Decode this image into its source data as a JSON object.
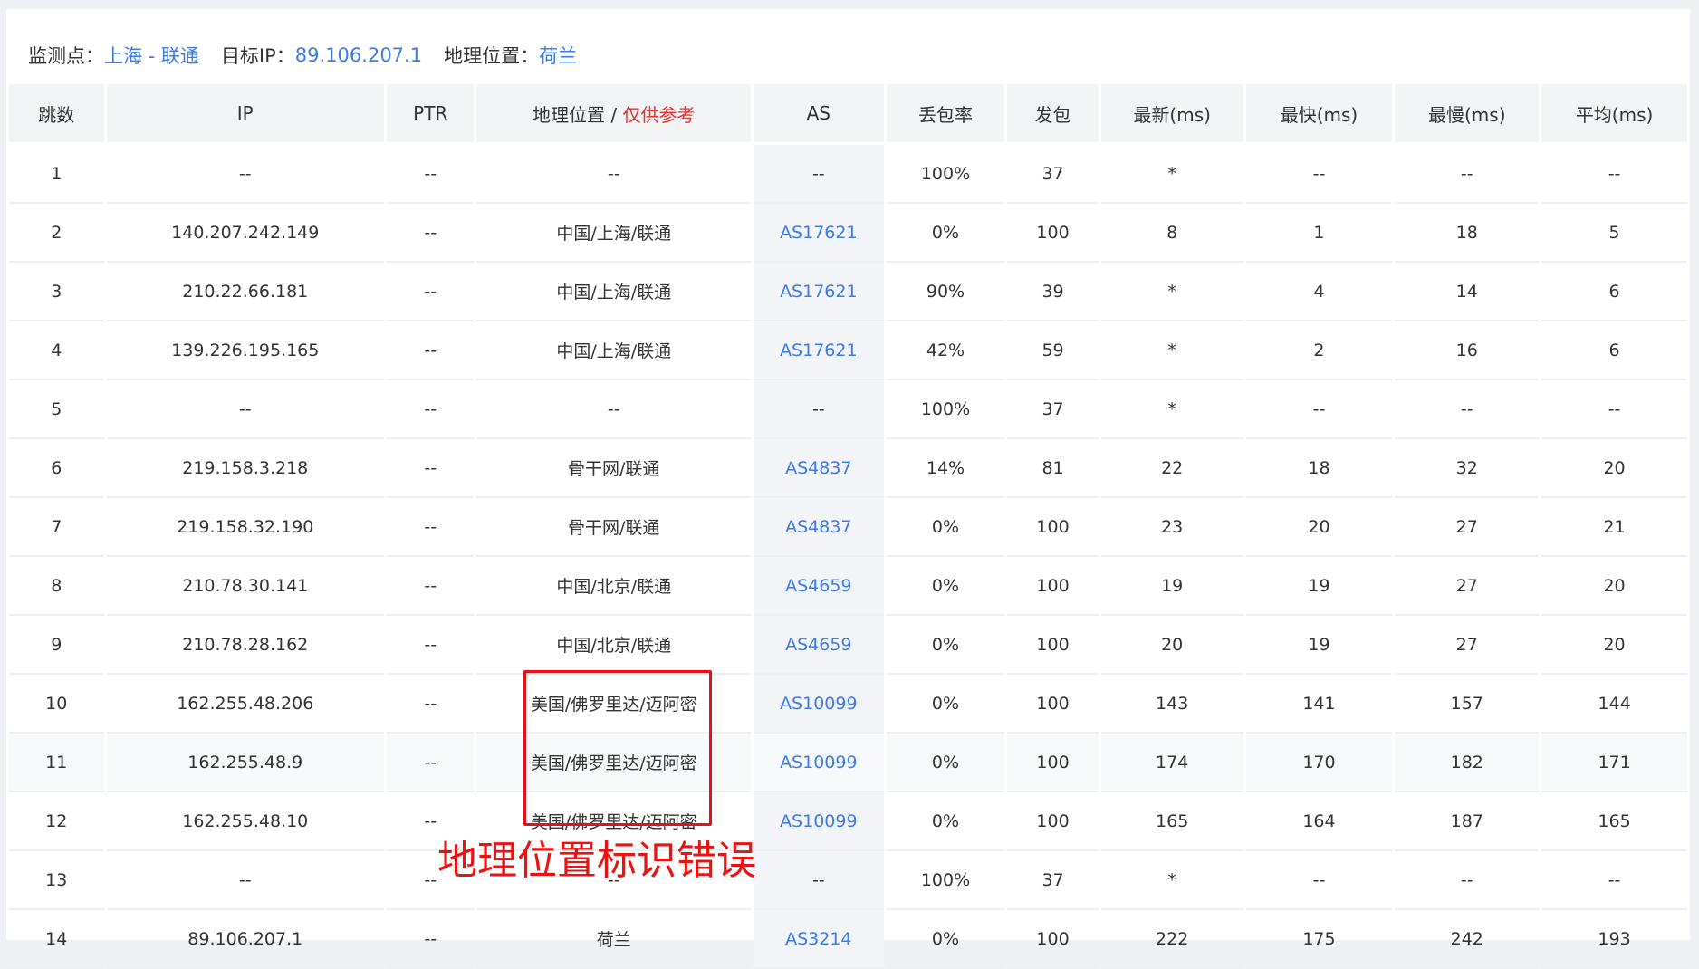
{
  "info": {
    "monitor_label": "监测点：",
    "monitor_value": "上海 - 联通",
    "target_label": "目标IP：",
    "target_value": "89.106.207.1",
    "geo_label": "地理位置：",
    "geo_value": "荷兰"
  },
  "columns": {
    "hop": "跳数",
    "ip": "IP",
    "ptr": "PTR",
    "geo": "地理位置 / ",
    "geo_note": "仅供参考",
    "as": "AS",
    "loss": "丢包率",
    "sent": "发包",
    "last": "最新(ms)",
    "best": "最快(ms)",
    "worst": "最慢(ms)",
    "avg": "平均(ms)"
  },
  "rows": [
    {
      "hop": "1",
      "ip": "--",
      "ptr": "--",
      "geo": "--",
      "as": "--",
      "loss": "100%",
      "sent": "37",
      "last": "*",
      "best": "--",
      "worst": "--",
      "avg": "--"
    },
    {
      "hop": "2",
      "ip": "140.207.242.149",
      "ptr": "--",
      "geo": "中国/上海/联通",
      "as": "AS17621",
      "loss": "0%",
      "sent": "100",
      "last": "8",
      "best": "1",
      "worst": "18",
      "avg": "5"
    },
    {
      "hop": "3",
      "ip": "210.22.66.181",
      "ptr": "--",
      "geo": "中国/上海/联通",
      "as": "AS17621",
      "loss": "90%",
      "sent": "39",
      "last": "*",
      "best": "4",
      "worst": "14",
      "avg": "6"
    },
    {
      "hop": "4",
      "ip": "139.226.195.165",
      "ptr": "--",
      "geo": "中国/上海/联通",
      "as": "AS17621",
      "loss": "42%",
      "sent": "59",
      "last": "*",
      "best": "2",
      "worst": "16",
      "avg": "6"
    },
    {
      "hop": "5",
      "ip": "--",
      "ptr": "--",
      "geo": "--",
      "as": "--",
      "loss": "100%",
      "sent": "37",
      "last": "*",
      "best": "--",
      "worst": "--",
      "avg": "--"
    },
    {
      "hop": "6",
      "ip": "219.158.3.218",
      "ptr": "--",
      "geo": "骨干网/联通",
      "as": "AS4837",
      "loss": "14%",
      "sent": "81",
      "last": "22",
      "best": "18",
      "worst": "32",
      "avg": "20"
    },
    {
      "hop": "7",
      "ip": "219.158.32.190",
      "ptr": "--",
      "geo": "骨干网/联通",
      "as": "AS4837",
      "loss": "0%",
      "sent": "100",
      "last": "23",
      "best": "20",
      "worst": "27",
      "avg": "21"
    },
    {
      "hop": "8",
      "ip": "210.78.30.141",
      "ptr": "--",
      "geo": "中国/北京/联通",
      "as": "AS4659",
      "loss": "0%",
      "sent": "100",
      "last": "19",
      "best": "19",
      "worst": "27",
      "avg": "20"
    },
    {
      "hop": "9",
      "ip": "210.78.28.162",
      "ptr": "--",
      "geo": "中国/北京/联通",
      "as": "AS4659",
      "loss": "0%",
      "sent": "100",
      "last": "20",
      "best": "19",
      "worst": "27",
      "avg": "20"
    },
    {
      "hop": "10",
      "ip": "162.255.48.206",
      "ptr": "--",
      "geo": "美国/佛罗里达/迈阿密",
      "as": "AS10099",
      "loss": "0%",
      "sent": "100",
      "last": "143",
      "best": "141",
      "worst": "157",
      "avg": "144"
    },
    {
      "hop": "11",
      "ip": "162.255.48.9",
      "ptr": "--",
      "geo": "美国/佛罗里达/迈阿密",
      "as": "AS10099",
      "loss": "0%",
      "sent": "100",
      "last": "174",
      "best": "170",
      "worst": "182",
      "avg": "171"
    },
    {
      "hop": "12",
      "ip": "162.255.48.10",
      "ptr": "--",
      "geo": "美国/佛罗里达/迈阿密",
      "as": "AS10099",
      "loss": "0%",
      "sent": "100",
      "last": "165",
      "best": "164",
      "worst": "187",
      "avg": "165"
    },
    {
      "hop": "13",
      "ip": "--",
      "ptr": "--",
      "geo": "--",
      "as": "--",
      "loss": "100%",
      "sent": "37",
      "last": "*",
      "best": "--",
      "worst": "--",
      "avg": "--"
    },
    {
      "hop": "14",
      "ip": "89.106.207.1",
      "ptr": "--",
      "geo": "荷兰",
      "as": "AS3214",
      "loss": "0%",
      "sent": "100",
      "last": "222",
      "best": "175",
      "worst": "242",
      "avg": "193"
    }
  ],
  "annotation": {
    "text": "地理位置标识错误",
    "color": "#ee1111"
  },
  "colors": {
    "link": "#3d7ce8",
    "note": "#e5302f",
    "box": "#e5101a"
  }
}
